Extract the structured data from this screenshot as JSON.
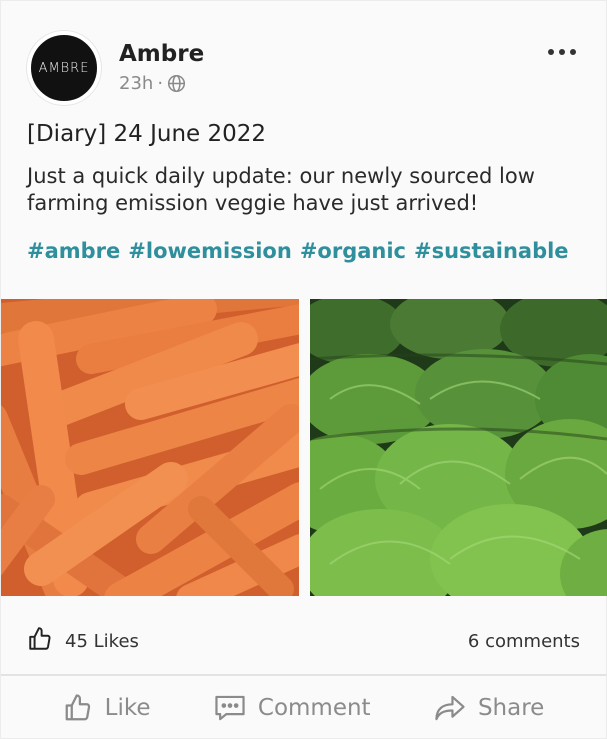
{
  "post": {
    "author": "Ambre",
    "avatar_text": "AMBRE",
    "time": "23h",
    "separator": "·",
    "visibility_icon": "globe-icon",
    "title": "[Diary] 24 June 2022",
    "body": "Just a quick daily update: our newly sourced low farming emission veggie have just arrived!",
    "hashtags": [
      "#ambre",
      "#lowemission",
      "#organic",
      "#sustainable"
    ],
    "images": [
      {
        "name": "carrots-photo"
      },
      {
        "name": "lettuce-photo"
      }
    ]
  },
  "stats": {
    "likes": "45 Likes",
    "comments": "6 comments"
  },
  "actions": {
    "like": "Like",
    "comment": "Comment",
    "share": "Share"
  },
  "colors": {
    "hashtag": "#2f8f9d",
    "muted": "#8b8b8b",
    "text": "#222222"
  }
}
